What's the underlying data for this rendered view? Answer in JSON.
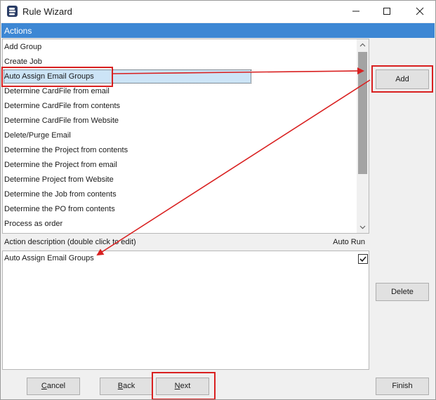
{
  "window": {
    "title": "Rule Wizard"
  },
  "titlebar_buttons": {
    "minimize": "minimize",
    "maximize": "maximize",
    "close": "close"
  },
  "actions": {
    "header": "Actions",
    "items": [
      "Add Group",
      "Create Job",
      "Auto Assign Email Groups",
      "Determine CardFile from email",
      "Determine CardFile from contents",
      "Determine CardFile from Website",
      "Delete/Purge Email",
      "Determine the Project from contents",
      "Determine the Project from email",
      "Determine Project from Website",
      "Determine the Job from contents",
      "Determine the PO from contents",
      "Process as order"
    ],
    "selected_index": 2
  },
  "description": {
    "label": "Action description (double click to edit)",
    "autorun_label": "Auto Run",
    "entries": [
      {
        "text": "Auto Assign Email Groups",
        "auto_run": true
      }
    ]
  },
  "buttons": {
    "add": "Add",
    "delete": "Delete",
    "cancel": "Cancel",
    "back": "Back",
    "next": "Next",
    "finish": "Finish"
  },
  "colors": {
    "accent": "#3d87d4",
    "selection": "#cce4f7",
    "annotation": "#d92020"
  }
}
